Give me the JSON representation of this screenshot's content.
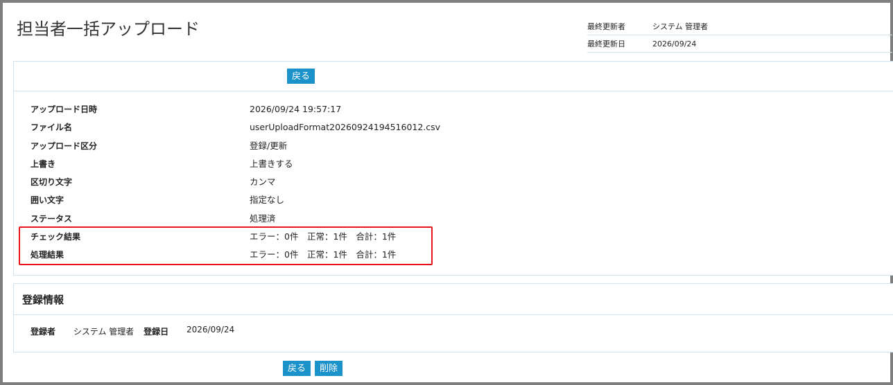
{
  "page": {
    "title": "担当者一括アップロード"
  },
  "meta": {
    "last_updated_by_label": "最終更新者",
    "last_updated_by_value": "システム 管理者",
    "last_updated_date_label": "最終更新日",
    "last_updated_date_value": "2026/09/24"
  },
  "toolbar": {
    "back_label": "戻る"
  },
  "details": [
    {
      "label": "アップロード日時",
      "value": "2026/09/24 19:57:17"
    },
    {
      "label": "ファイル名",
      "value": "userUploadFormat20260924194516012.csv"
    },
    {
      "label": "アップロード区分",
      "value": "登録/更新"
    },
    {
      "label": "上書き",
      "value": "上書きする"
    },
    {
      "label": "区切り文字",
      "value": "カンマ"
    },
    {
      "label": "囲い文字",
      "value": "指定なし"
    },
    {
      "label": "ステータス",
      "value": "処理済"
    },
    {
      "label": "チェック結果",
      "value": "エラー：0件　正常：1件　合計：1件"
    },
    {
      "label": "処理結果",
      "value": "エラー：0件　正常：1件　合計：1件"
    }
  ],
  "registration": {
    "section_title": "登録情報",
    "registrant_label": "登録者",
    "registrant_value": "システム 管理者",
    "registered_date_label": "登録日",
    "registered_date_value": "2026/09/24"
  },
  "footer": {
    "back_label": "戻る",
    "delete_label": "削除"
  },
  "colors": {
    "button_bg": "#1b92c9",
    "highlight_border": "#e8121b",
    "panel_border": "#cfe2ee"
  }
}
